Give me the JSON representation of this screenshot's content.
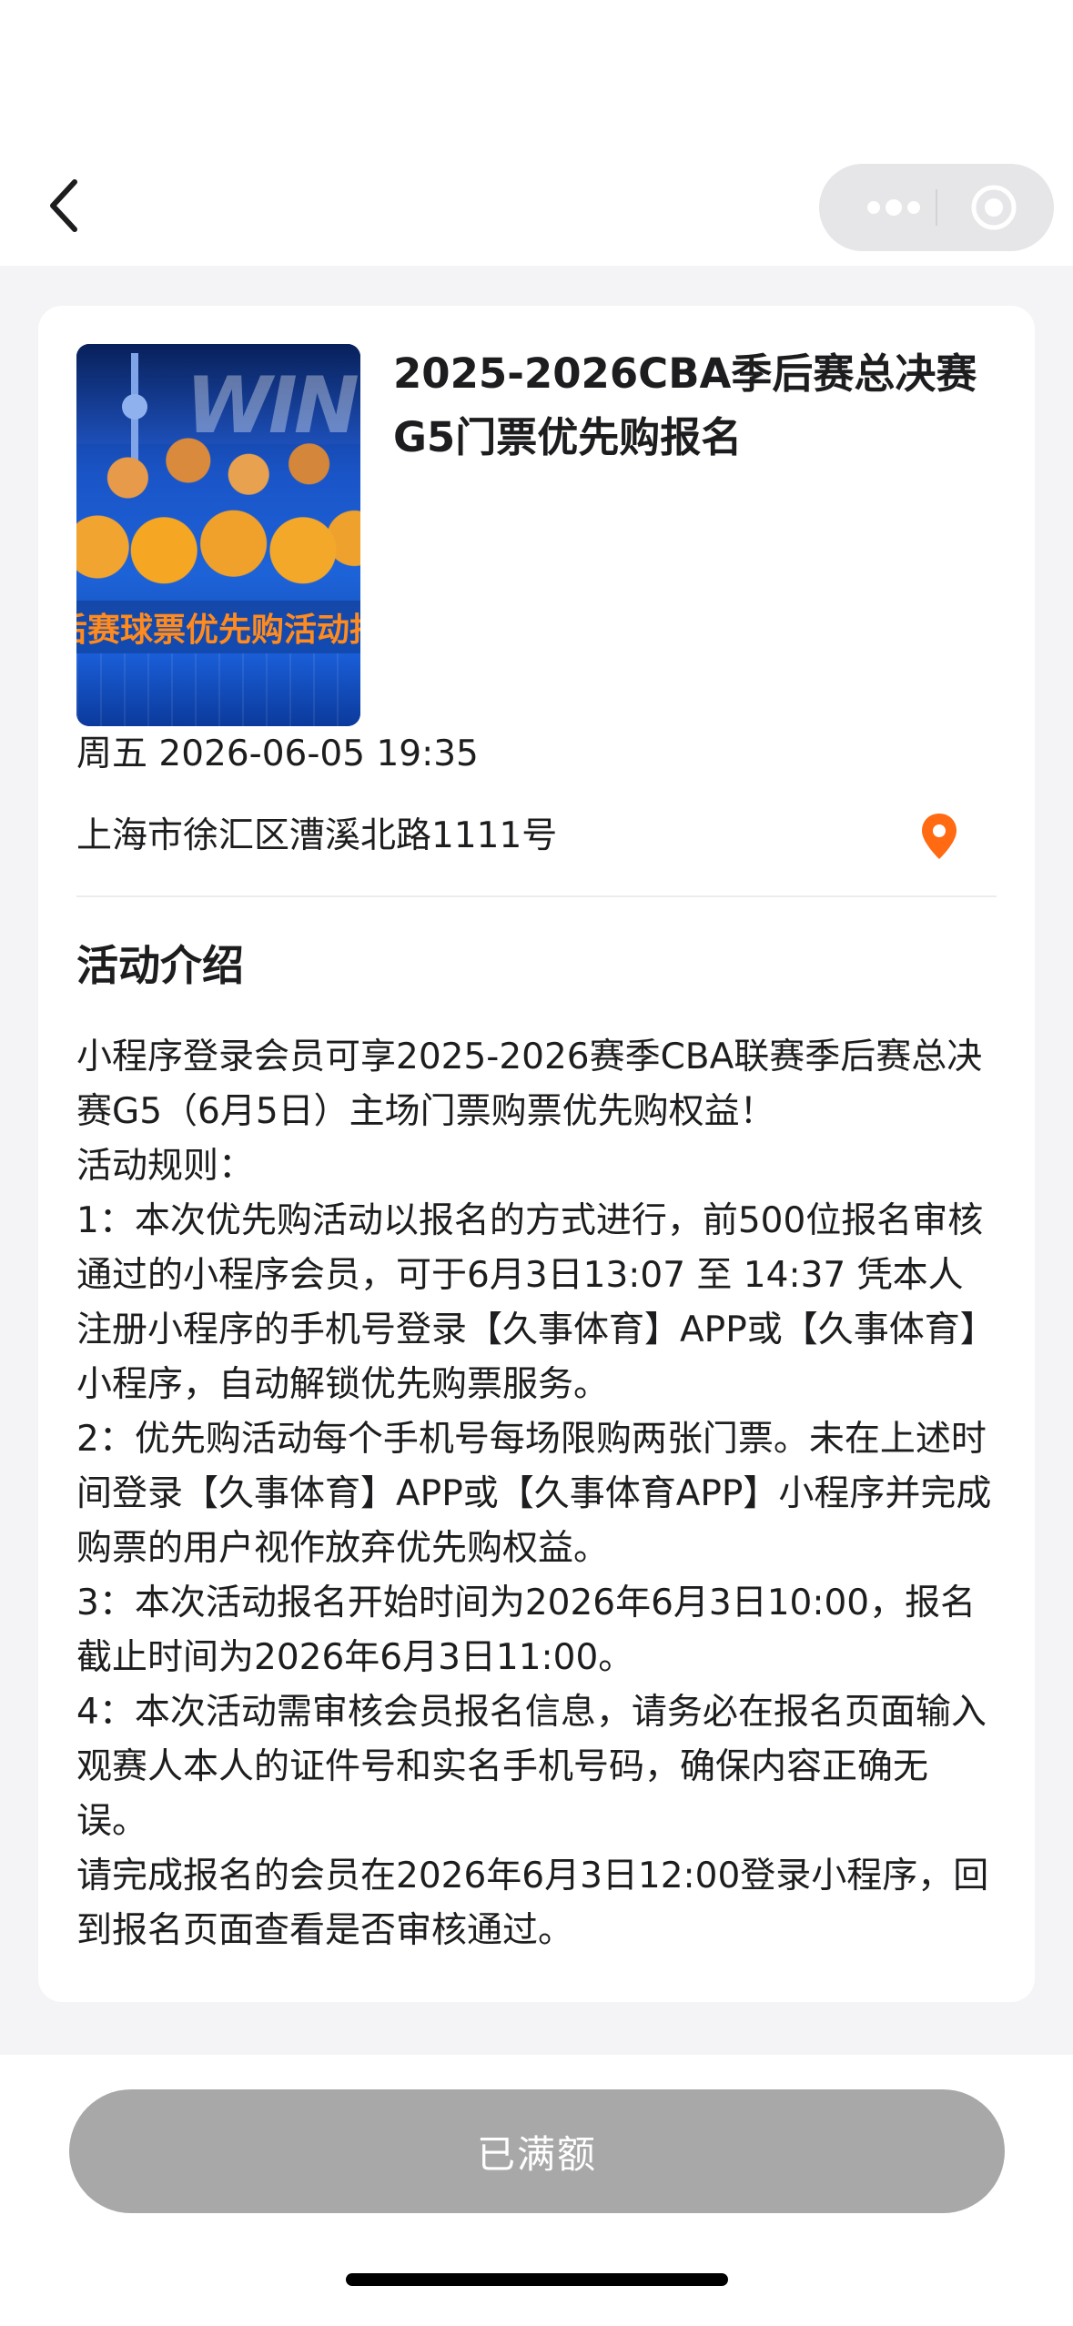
{
  "colors": {
    "accent_pin": "#ff6a13",
    "button_disabled": "#a8a8a8",
    "page_bg": "#f4f4f6"
  },
  "nav": {
    "back_icon": "chevron-left-icon",
    "capsule": {
      "more_icon": "more-dots-icon",
      "close_icon": "target-close-icon"
    }
  },
  "event": {
    "poster_banner": "后赛球票优先购活动报",
    "poster_letters": "WIN",
    "title": "2025-2026CBA季后赛总决赛G5门票优先购报名",
    "datetime": "周五 2026-06-05 19:35",
    "address": "上海市徐汇区漕溪北路1111号",
    "pin_icon": "location-pin-icon"
  },
  "intro": {
    "heading": "活动介绍",
    "paragraphs": [
      "小程序登录会员可享2025-2026赛季CBA联赛季后赛总决赛G5（6月5日）主场门票购票优先购权益！",
      "活动规则：",
      "1：本次优先购活动以报名的方式进行，前500位报名审核通过的小程序会员，可于6月3日13:07 至 14:37 凭本人注册小程序的手机号登录【久事体育】APP或【久事体育】小程序，自动解锁优先购票服务。",
      "2：优先购活动每个手机号每场限购两张门票。未在上述时间登录【久事体育】APP或【久事体育APP】小程序并完成购票的用户视作放弃优先购权益。",
      "3：本次活动报名开始时间为2026年6月3日10:00，报名截止时间为2026年6月3日11:00。",
      "4：本次活动需审核会员报名信息，请务必在报名页面输入观赛人本人的证件号和实名手机号码，确保内容正确无误。",
      "请完成报名的会员在2026年6月3日12:00登录小程序，回到报名页面查看是否审核通过。"
    ]
  },
  "footer": {
    "button_label": "已满额"
  }
}
